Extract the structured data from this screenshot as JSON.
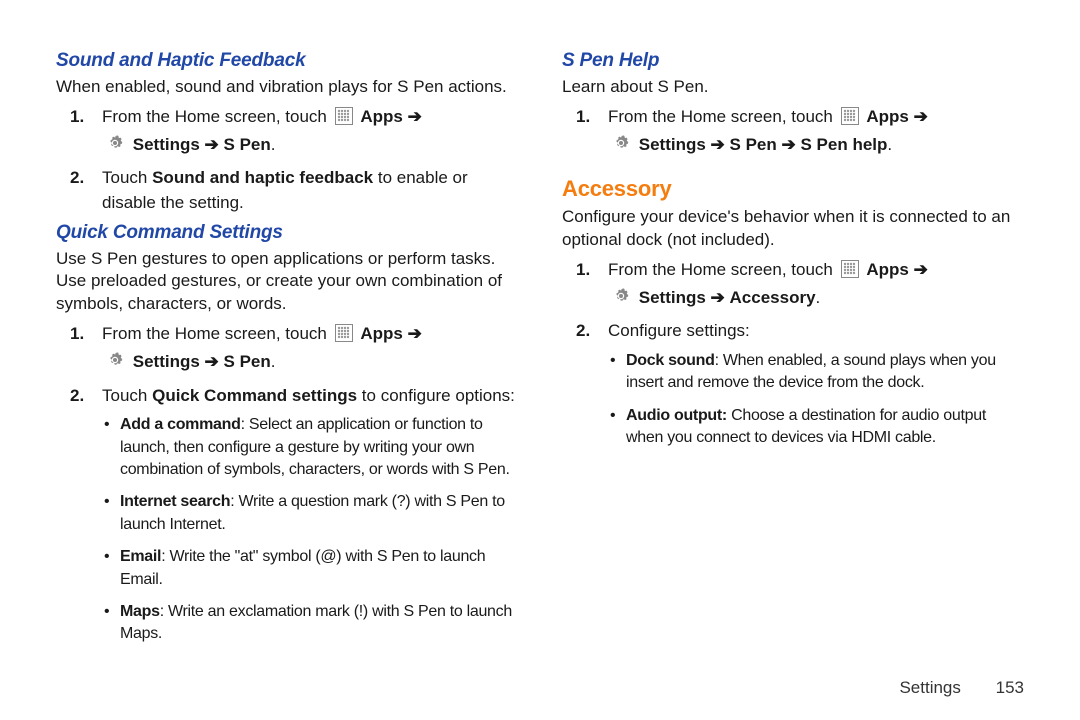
{
  "arrow": "➔",
  "labels": {
    "apps": "Apps",
    "settings": "Settings",
    "spen": "S Pen",
    "spenhelp": "S Pen help",
    "accessory": "Accessory"
  },
  "left": {
    "sound_haptic": {
      "heading": "Sound and Haptic Feedback",
      "intro": "When enabled, sound and vibration plays for S Pen actions.",
      "steps": [
        {
          "n": "1.",
          "pre": "From the Home screen, touch "
        },
        {
          "n": "2.",
          "pre": "Touch ",
          "bold": "Sound and haptic feedback",
          "post": " to enable or disable the setting."
        }
      ]
    },
    "quick_command": {
      "heading": "Quick Command Settings",
      "intro": "Use S Pen gestures to open applications or perform tasks. Use preloaded gestures, or create your own combination of symbols, characters, or words.",
      "steps": [
        {
          "n": "1.",
          "pre": "From the Home screen, touch "
        },
        {
          "n": "2.",
          "pre": "Touch ",
          "bold": "Quick Command settings",
          "post": " to configure options:"
        }
      ],
      "bullets": [
        {
          "bold": "Add a command",
          "rest": ": Select an application or function to launch, then configure a gesture by writing your own combination of symbols, characters, or words with S Pen."
        },
        {
          "bold": "Internet search",
          "rest": ": Write a question mark (?) with S Pen to launch Internet."
        },
        {
          "bold": "Email",
          "rest": ": Write the \"at\" symbol (@) with S Pen to launch Email."
        },
        {
          "bold": "Maps",
          "rest": ": Write an exclamation mark (!) with S Pen to launch Maps."
        }
      ]
    }
  },
  "right": {
    "spen_help": {
      "heading": "S Pen Help",
      "intro": "Learn about S Pen.",
      "steps": [
        {
          "n": "1.",
          "pre": "From the Home screen, touch "
        }
      ]
    },
    "accessory": {
      "heading": "Accessory",
      "intro": "Configure your device's behavior when it is connected to an optional dock (not included).",
      "steps": [
        {
          "n": "1.",
          "pre": "From the Home screen, touch "
        },
        {
          "n": "2.",
          "text": "Configure settings:"
        }
      ],
      "bullets": [
        {
          "bold": "Dock sound",
          "rest": ": When enabled, a sound plays when you insert and remove the device from the dock."
        },
        {
          "bold": "Audio output:",
          "rest": " Choose a destination for audio output when you connect to devices via HDMI cable."
        }
      ]
    }
  },
  "footer": {
    "section": "Settings",
    "page": "153"
  }
}
